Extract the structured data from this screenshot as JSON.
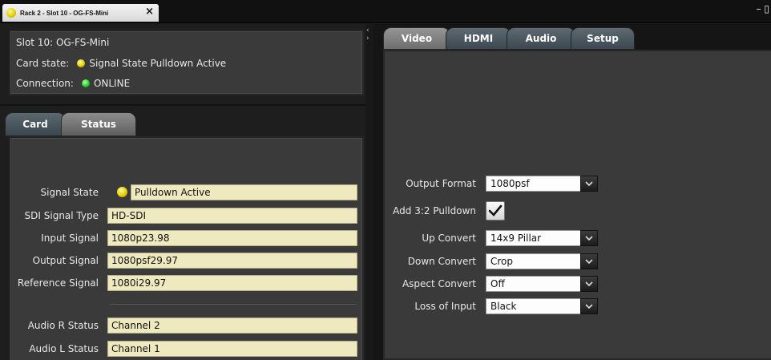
{
  "window": {
    "tab_title": "Rack 2 - Slot 10 - OG-FS-Mini",
    "close_glyph": "×",
    "controls_glyph": "– ▯"
  },
  "info": {
    "slot": "Slot 10: OG-FS-Mini",
    "card_state_label": "Card state:",
    "card_state_value": "Signal State Pulldown Active",
    "connection_label": "Connection:",
    "connection_value": "ONLINE"
  },
  "left_tabs": [
    {
      "label": "Card",
      "active": false
    },
    {
      "label": "Status",
      "active": true
    }
  ],
  "status": {
    "signal_state_label": "Signal State",
    "signal_state_value": "Pulldown Active",
    "sdi_type_label": "SDI Signal Type",
    "sdi_type_value": "HD-SDI",
    "input_signal_label": "Input Signal",
    "input_signal_value": "1080p23.98",
    "output_signal_label": "Output Signal",
    "output_signal_value": "1080psf29.97",
    "reference_signal_label": "Reference Signal",
    "reference_signal_value": "1080i29.97",
    "audio_r_label": "Audio R Status",
    "audio_r_value": "Channel 2",
    "audio_l_label": "Audio L Status",
    "audio_l_value": "Channel 1"
  },
  "right_tabs": [
    {
      "label": "Video",
      "active": true
    },
    {
      "label": "HDMI",
      "active": false
    },
    {
      "label": "Audio",
      "active": false
    },
    {
      "label": "Setup",
      "active": false
    }
  ],
  "video": {
    "output_format_label": "Output Format",
    "output_format_value": "1080psf",
    "pulldown_label": "Add 3:2 Pulldown",
    "pulldown_checked": true,
    "up_convert_label": "Up Convert",
    "up_convert_value": "14x9 Pillar",
    "down_convert_label": "Down Convert",
    "down_convert_value": "Crop",
    "aspect_convert_label": "Aspect Convert",
    "aspect_convert_value": "Off",
    "loss_of_input_label": "Loss of Input",
    "loss_of_input_value": "Black"
  },
  "colors": {
    "field_bg": "#efe9bf",
    "led_yellow": "#e5d000",
    "led_green": "#21d02a",
    "panel_bg": "#3a3a3a"
  }
}
